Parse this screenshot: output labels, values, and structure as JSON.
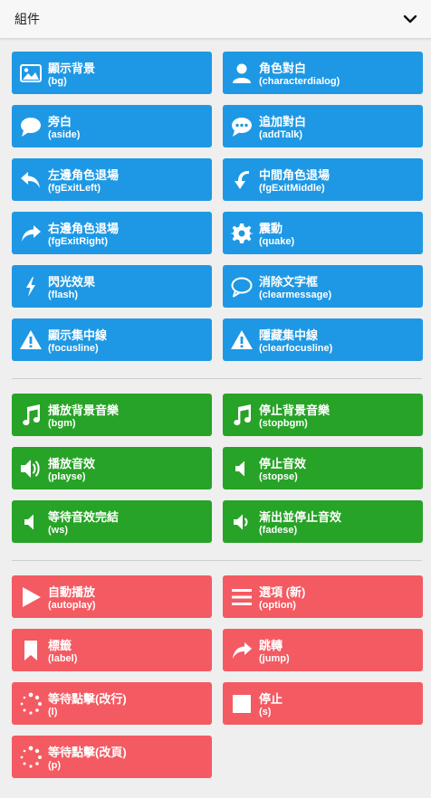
{
  "panel": {
    "title": "組件"
  },
  "groups": [
    {
      "color": "#1e98e4",
      "items": [
        {
          "name": "顯示背景",
          "cmd": "(bg)",
          "icon": "image-icon"
        },
        {
          "name": "角色對白",
          "cmd": "(characterdialog)",
          "icon": "user-icon"
        },
        {
          "name": "旁白",
          "cmd": "(aside)",
          "icon": "speech-bubble-icon"
        },
        {
          "name": "追加對白",
          "cmd": "(addTalk)",
          "icon": "chat-dots-icon"
        },
        {
          "name": "左邊角色退場",
          "cmd": "(fgExitLeft)",
          "icon": "reply-arrow-icon"
        },
        {
          "name": "中間角色退場",
          "cmd": "(fgExitMiddle)",
          "icon": "down-curve-arrow-icon"
        },
        {
          "name": "右邊角色退場",
          "cmd": "(fgExitRight)",
          "icon": "forward-arrow-icon"
        },
        {
          "name": "震動",
          "cmd": "(quake)",
          "icon": "gear-icon"
        },
        {
          "name": "閃光效果",
          "cmd": "(flash)",
          "icon": "lightning-icon"
        },
        {
          "name": "消除文字框",
          "cmd": "(clearmessage)",
          "icon": "speech-outline-icon"
        },
        {
          "name": "顯示集中線",
          "cmd": "(focusline)",
          "icon": "warning-icon"
        },
        {
          "name": "隱藏集中線",
          "cmd": "(clearfocusline)",
          "icon": "warning-icon"
        }
      ]
    },
    {
      "color": "#27a327",
      "items": [
        {
          "name": "播放背景音樂",
          "cmd": "(bgm)",
          "icon": "music-note-icon"
        },
        {
          "name": "停止背景音樂",
          "cmd": "(stopbgm)",
          "icon": "music-note-icon"
        },
        {
          "name": "播放音效",
          "cmd": "(playse)",
          "icon": "volume-up-icon"
        },
        {
          "name": "停止音效",
          "cmd": "(stopse)",
          "icon": "volume-off-icon"
        },
        {
          "name": "等待音效完結",
          "cmd": "(ws)",
          "icon": "volume-off-icon"
        },
        {
          "name": "漸出並停止音效",
          "cmd": "(fadese)",
          "icon": "volume-down-icon"
        }
      ]
    },
    {
      "color": "#f45a62",
      "items": [
        {
          "name": "自動播放",
          "cmd": "(autoplay)",
          "icon": "play-icon"
        },
        {
          "name": "選項 (新)",
          "cmd": "(option)",
          "icon": "menu-lines-icon"
        },
        {
          "name": "標籤",
          "cmd": "(label)",
          "icon": "bookmark-icon"
        },
        {
          "name": "跳轉",
          "cmd": "(jump)",
          "icon": "forward-arrow-icon"
        },
        {
          "name": "等待點擊(改行)",
          "cmd": "(l)",
          "icon": "spinner-icon"
        },
        {
          "name": "停止",
          "cmd": "(s)",
          "icon": "stop-square-icon"
        },
        {
          "name": "等待點擊(改頁)",
          "cmd": "(p)",
          "icon": "spinner-icon"
        }
      ]
    }
  ]
}
